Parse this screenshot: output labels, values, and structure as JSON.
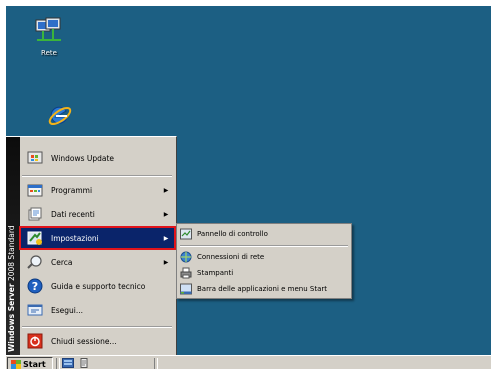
{
  "desktop": {
    "icons": [
      {
        "label": "Rete",
        "icon": "network-icon"
      },
      {
        "label": "",
        "icon": "internet-explorer-icon"
      }
    ]
  },
  "start_menu": {
    "sidebar_text_bold": "Windows Server",
    "sidebar_text_rest": " 2008 Standard",
    "items": [
      {
        "label": "Windows Update",
        "icon": "windows-update-icon",
        "submenu": false
      },
      {
        "label": "Programmi",
        "icon": "programs-icon",
        "submenu": true
      },
      {
        "label": "Dati recenti",
        "icon": "recent-documents-icon",
        "submenu": true
      },
      {
        "label": "Impostazioni",
        "icon": "settings-icon",
        "submenu": true,
        "selected": true
      },
      {
        "label": "Cerca",
        "icon": "search-icon",
        "submenu": true
      },
      {
        "label": "Guida e supporto tecnico",
        "icon": "help-icon",
        "submenu": false
      },
      {
        "label": "Esegui...",
        "icon": "run-icon",
        "submenu": false
      },
      {
        "label": "Chiudi sessione...",
        "icon": "shutdown-icon",
        "submenu": false
      }
    ]
  },
  "settings_submenu": {
    "items": [
      {
        "label": "Pannello di controllo",
        "icon": "control-panel-icon"
      },
      {
        "label": "Connessioni di rete",
        "icon": "network-connections-icon"
      },
      {
        "label": "Stampanti",
        "icon": "printers-icon"
      },
      {
        "label": "Barra delle applicazioni e menu Start",
        "icon": "taskbar-icon"
      }
    ]
  },
  "taskbar": {
    "start_label": "Start",
    "quick_launch": [
      "server-manager-icon",
      "command-prompt-icon"
    ]
  },
  "colors": {
    "desktop": "#1c5f83",
    "menu_bg": "#d4d0c8",
    "selection": "#0a246a",
    "highlight_border": "#e0141b"
  }
}
